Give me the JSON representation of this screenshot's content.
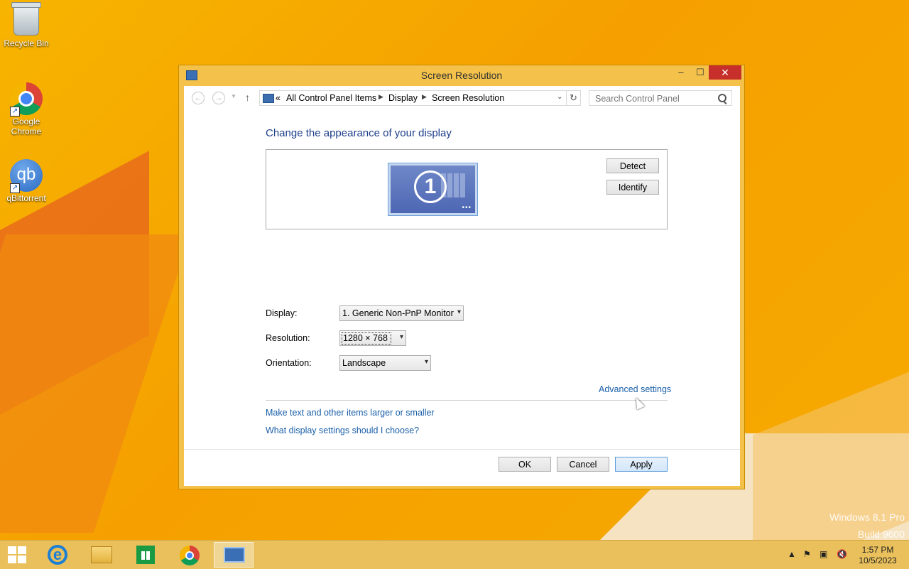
{
  "desktop": {
    "icons": [
      {
        "label": "Recycle Bin"
      },
      {
        "label": "Google Chrome"
      },
      {
        "label": "qBittorrent",
        "glyph": "qb"
      }
    ],
    "watermark": {
      "line1": "Windows 8.1 Pro",
      "line2": "Build 9600"
    }
  },
  "window": {
    "title": "Screen Resolution",
    "controls": {
      "minimize": "–",
      "maximize": "☐",
      "close": "✕"
    },
    "address": {
      "overflow": "«",
      "crumbs": [
        "All Control Panel Items",
        "Display",
        "Screen Resolution"
      ],
      "search_placeholder": "Search Control Panel"
    },
    "content": {
      "heading": "Change the appearance of your display",
      "monitor_number": "1",
      "detect_label": "Detect",
      "identify_label": "Identify",
      "display_label": "Display:",
      "display_value": "1. Generic Non-PnP Monitor",
      "resolution_label": "Resolution:",
      "resolution_value": "1280 × 768",
      "orientation_label": "Orientation:",
      "orientation_value": "Landscape",
      "advanced_link": "Advanced settings",
      "link_text_size": "Make text and other items larger or smaller",
      "link_help": "What display settings should I choose?",
      "ok_label": "OK",
      "cancel_label": "Cancel",
      "apply_label": "Apply"
    }
  },
  "taskbar": {
    "apps": [
      {
        "name": "internet-explorer"
      },
      {
        "name": "file-explorer"
      },
      {
        "name": "store"
      },
      {
        "name": "google-chrome"
      },
      {
        "name": "screen-resolution",
        "active": true
      }
    ],
    "clock": {
      "time": "1:57 PM",
      "date": "10/5/2023"
    }
  },
  "colors": {
    "desktop": "#f5a800",
    "window_frame": "#f4c24a",
    "link": "#1a5fa8",
    "heading": "#1e3f8a",
    "close": "#c7302a"
  }
}
